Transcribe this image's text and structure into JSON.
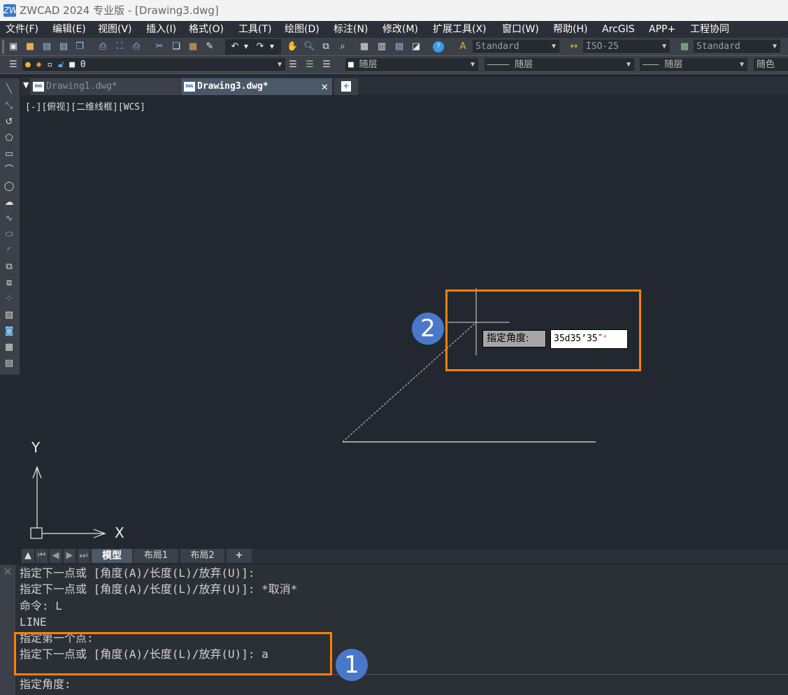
{
  "window": {
    "title": "ZWCAD 2024 专业版 - [Drawing3.dwg]",
    "logo": "ZW"
  },
  "menu": [
    "文件(F)",
    "编辑(E)",
    "视图(V)",
    "插入(I)",
    "格式(O)",
    "工具(T)",
    "绘图(D)",
    "标注(N)",
    "修改(M)",
    "扩展工具(X)",
    "窗口(W)",
    "帮助(H)",
    "ArcGIS",
    "APP+",
    "工程协同"
  ],
  "toolbar": {
    "text_style": "Standard",
    "dim_style": "ISO-25",
    "table_style": "Standard",
    "layer": "0",
    "color": "随层",
    "linetype": "随层",
    "lineweight": "随层",
    "plot_style": "随色"
  },
  "tabs": [
    {
      "label": "Drawing1.dwg*",
      "active": false
    },
    {
      "label": "Drawing3.dwg*",
      "active": true
    }
  ],
  "viewport_label": "[-][俯视][二维线框][WCS]",
  "ucs": {
    "x": "X",
    "y": "Y"
  },
  "dynamic_input": {
    "label": "指定角度:",
    "value": "35d35’35″"
  },
  "layout_tabs": [
    "模型",
    "布局1",
    "布局2",
    "+"
  ],
  "command_history": [
    "指定下一点或 [角度(A)/长度(L)/放弃(U)]:",
    "指定下一点或 [角度(A)/长度(L)/放弃(U)]: *取消*",
    "命令: L",
    "LINE",
    "指定第一个点:",
    "指定下一点或 [角度(A)/长度(L)/放弃(U)]: a"
  ],
  "command_prompt": "指定角度:",
  "callouts": [
    "1",
    "2"
  ],
  "colors": {
    "accent_box": "#ff7f00",
    "callout": "#4a78c8",
    "canvas": "#232830"
  }
}
